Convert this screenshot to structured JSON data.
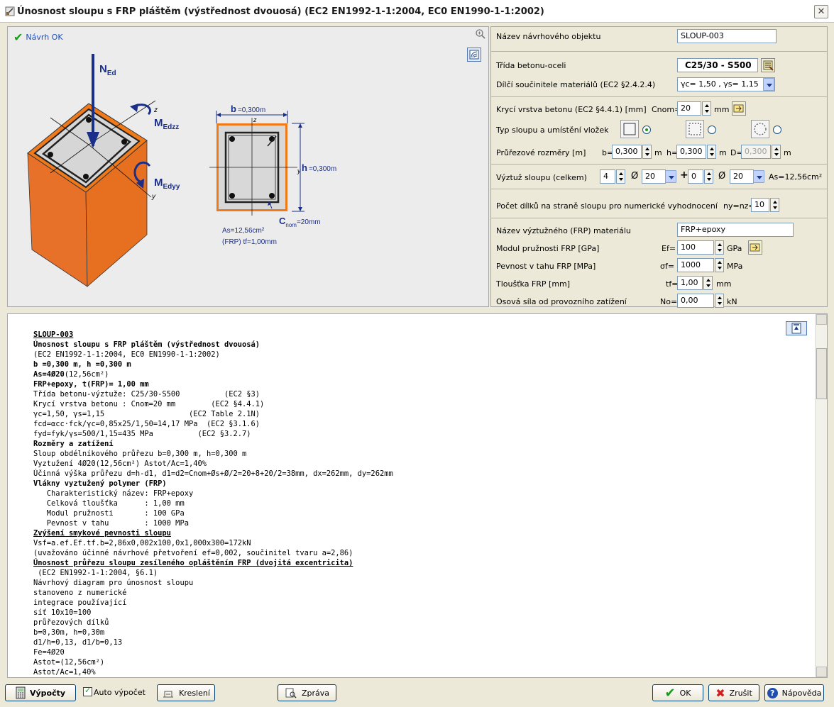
{
  "window": {
    "title": "Únosnost sloupu s FRP pláštěm (výstřednost dvouosá) (EC2 EN1992-1-1:2004, EC0 EN1990-1-1:2002)"
  },
  "drawing": {
    "status": "Návrh OK",
    "labels_3d": {
      "n": "N",
      "n_sub": "Ed",
      "mz": "M",
      "mz_sub": "Edzz",
      "my": "M",
      "my_sub": "Edyy",
      "z": "z",
      "y": "y"
    },
    "section": {
      "b_label": "b",
      "b_value": "=0,300m",
      "h_label": "h",
      "h_value": "=0,300m",
      "c_label": "C",
      "c_sub": "nom",
      "c_value": "=20mm",
      "z": "z",
      "y": "y",
      "as_text": "As=12,56cm²",
      "frp_text": "(FRP) tf=1,00mm"
    }
  },
  "form": {
    "object_name_label": "Název návrhového objektu",
    "object_name": "SLOUP-003",
    "class_label": "Třída betonu-oceli",
    "class_value": "C25/30 - S500",
    "factors_label": "Dílčí součinitele materiálů (EC2 §2.4.2.4)",
    "factors_value": "γc= 1,50 , γs= 1,15",
    "cover_label": "Krycí vrstva betonu (EC2 §4.4.1) [mm]",
    "cover_prefix": "Cnom=",
    "cover_value": "20",
    "cover_unit": "mm",
    "type_label": "Typ sloupu a umístění vložek",
    "dims_label": "Průřezové rozměry [m]",
    "b_prefix": "b=",
    "b_value": "0,300",
    "b_unit": "m",
    "h_prefix": "h=",
    "h_value": "0,300",
    "h_unit": "m",
    "d_prefix": "D=",
    "d_value": "0,300",
    "d_unit": "m",
    "reinf_label": "Výztuž sloupu (celkem)",
    "reinf_n1": "4",
    "reinf_dia_sym": "Ø",
    "reinf_d1": "20",
    "reinf_plus": "+",
    "reinf_n2": "0",
    "reinf_d2": "20",
    "reinf_as": "As=12,56cm²",
    "mesh_label": "Počet dílků na straně sloupu pro numerické vyhodnocení",
    "mesh_prefix": "ny=nz=",
    "mesh_value": "10",
    "frp_name_label": "Název výztužného (FRP) materiálu",
    "frp_name": "FRP+epoxy",
    "ef_label": "Modul pružnosti FRP [GPa]",
    "ef_prefix": "Ef=",
    "ef_value": "100",
    "ef_unit": "GPa",
    "sf_label": "Pevnost v tahu FRP [MPa]",
    "sf_prefix": "σf=",
    "sf_value": "1000",
    "sf_unit": "MPa",
    "tf_label": "Tloušťka FRP [mm]",
    "tf_prefix": "tf=",
    "tf_value": "1,00",
    "tf_unit": "mm",
    "no_label": "Osová síla od provozního zatížení",
    "no_prefix": "No=",
    "no_value": "0,00",
    "no_unit": "kN"
  },
  "report": {
    "lines": [
      {
        "t": "SLOUP-003",
        "s": "u"
      },
      {
        "t": "Únosnost sloupu s FRP pláštěm (výstřednost dvouosá)",
        "s": "b"
      },
      {
        "t": "(EC2 EN1992-1-1:2004, EC0 EN1990-1-1:2002)",
        "s": ""
      },
      {
        "t": "b =0,300 m, h =0,300 m",
        "s": "b"
      },
      {
        "t": "As=4Ø20(12,56cm²)",
        "s": "mix",
        "b": "As=4Ø20",
        "r": "(12,56cm²)"
      },
      {
        "t": "FRP+epoxy, t(FRP)= 1,00 mm",
        "s": "b"
      },
      {
        "t": "Třída betonu-výztuže: C25/30-S500          (EC2 §3)",
        "s": ""
      },
      {
        "t": "Krycí vrstva betonu : Cnom=20 mm        (EC2 §4.4.1)",
        "s": ""
      },
      {
        "t": "γc=1,50, γs=1,15                   (EC2 Table 2.1N)",
        "s": ""
      },
      {
        "t": "fcd=αcc·fck/γc=0,85x25/1,50=14,17 MPa  (EC2 §3.1.6)",
        "s": ""
      },
      {
        "t": "fyd=fyk/γs=500/1,15=435 MPa          (EC2 §3.2.7)",
        "s": ""
      },
      {
        "t": "Rozměry a zatížení",
        "s": "b"
      },
      {
        "t": "Sloup obdélníkového průřezu b=0,300 m, h=0,300 m",
        "s": ""
      },
      {
        "t": "Vyztužení 4Ø20(12,56cm²) Astot/Ac=1,40%",
        "s": ""
      },
      {
        "t": "Účinná výška průřezu d=h-d1, d1=d2=Cnom+Øs+Ø/2=20+8+20/2=38mm, dx=262mm, dy=262mm",
        "s": ""
      },
      {
        "t": "Vlákny vyztužený polymer (FRP)",
        "s": "b"
      },
      {
        "t": "   Charakteristický název: FRP+epoxy",
        "s": ""
      },
      {
        "t": "   Celková tloušťka      : 1,00 mm",
        "s": ""
      },
      {
        "t": "   Modul pružnosti       : 100 GPa",
        "s": ""
      },
      {
        "t": "   Pevnost v tahu        : 1000 MPa",
        "s": ""
      },
      {
        "t": "Zvýšení smykové pevnosti sloupu",
        "s": "u"
      },
      {
        "t": "Vsf=a.ef.Ef.tf.b=2,86x0,002x100,0x1,000x300=172kN",
        "s": ""
      },
      {
        "t": "(uvažováno účinné návrhové přetvoření ef=0,002, součinitel tvaru a=2,86)",
        "s": ""
      },
      {
        "t": "Únosnost průřezu sloupu zesíleného opláštěním FRP (dvojitá excentricita)",
        "s": "u"
      },
      {
        "t": " (EC2 EN1992-1-1:2004, §6.1)",
        "s": ""
      },
      {
        "t": "Návrhový diagram pro únosnost sloupu",
        "s": ""
      },
      {
        "t": "stanoveno z numerické",
        "s": ""
      },
      {
        "t": "integrace používající",
        "s": ""
      },
      {
        "t": "síť 10x10=100",
        "s": ""
      },
      {
        "t": "průřezových dílků",
        "s": ""
      },
      {
        "t": "b=0,30m, h=0,30m",
        "s": ""
      },
      {
        "t": "d1/h=0,13, d1/b=0,13",
        "s": ""
      },
      {
        "t": "Fe=4Ø20",
        "s": ""
      },
      {
        "t": "Astot=(12,56cm²)",
        "s": ""
      },
      {
        "t": "Astot/Ac=1,40%",
        "s": ""
      }
    ]
  },
  "buttons": {
    "calc": "Výpočty",
    "auto": "Auto výpočet",
    "draw": "Kreslení",
    "report": "Zpráva",
    "ok": "OK",
    "cancel": "Zrušit",
    "help": "Nápověda"
  },
  "colors": {
    "frp_orange": "#f07a1a",
    "concrete": "#c8c8c8",
    "accent_blue": "#1a2f8a"
  }
}
